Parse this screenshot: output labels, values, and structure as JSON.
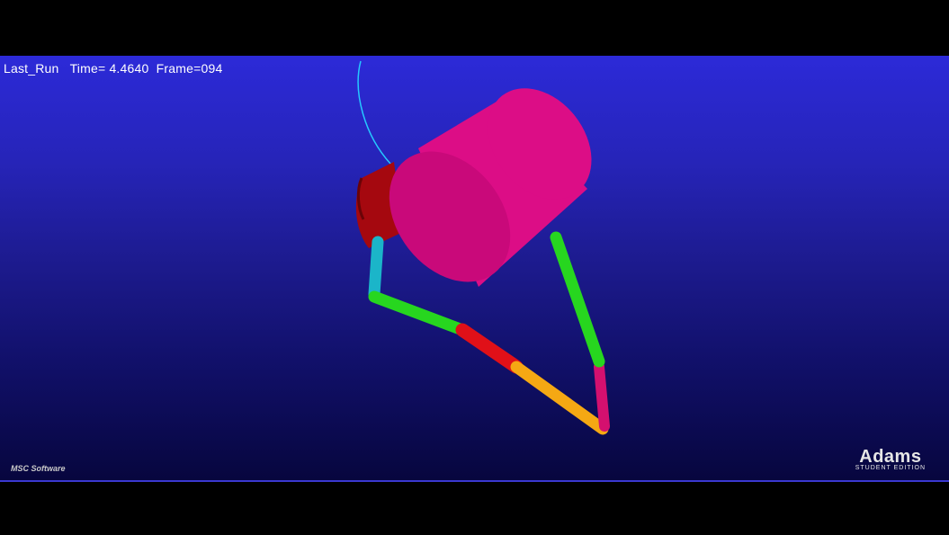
{
  "viewport": {
    "analysis_name": "Last_Run",
    "time_label": "Time=",
    "time_value": "4.4640",
    "frame_label": "Frame=094"
  },
  "scene": {
    "bodies": [
      {
        "name": "drum-cylinder",
        "color": "#e0117f"
      },
      {
        "name": "red-bucket-part",
        "color": "#b30a12"
      },
      {
        "name": "cyan-link",
        "color": "#1bb5c9"
      },
      {
        "name": "green-lower-link",
        "color": "#27d61f"
      },
      {
        "name": "red-mid-link",
        "color": "#e01018"
      },
      {
        "name": "orange-link",
        "color": "#f5a813"
      },
      {
        "name": "magenta-short-link",
        "color": "#d4106f"
      },
      {
        "name": "green-right-link",
        "color": "#27d61f"
      },
      {
        "name": "trace-curve",
        "color": "#25c8ff"
      }
    ]
  },
  "branding": {
    "msc": "MSC Software",
    "adams_title": "Adams",
    "adams_sub": "STUDENT EDITION"
  }
}
